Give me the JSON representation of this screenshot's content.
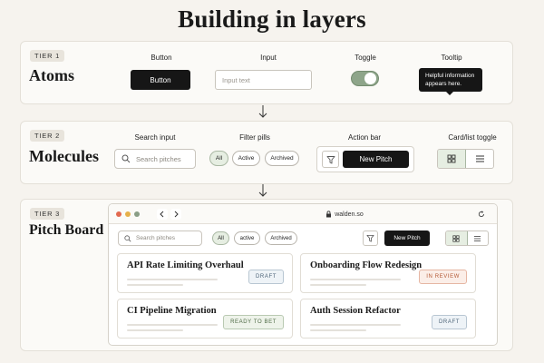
{
  "title": "Building in layers",
  "tiers": [
    {
      "badge": "TIER 1",
      "name": "Atoms",
      "columns": {
        "button": "Button",
        "input": "Input",
        "toggle": "Toggle",
        "tooltip": "Tooltip"
      },
      "button_label": "Button",
      "input_placeholder": "Input text",
      "toggle_on": true,
      "tooltip_text": "Helpful information appears here."
    },
    {
      "badge": "TIER 2",
      "name": "Molecules",
      "columns": {
        "search": "Search input",
        "filter": "Filter pills",
        "action": "Action bar",
        "view": "Card/list toggle"
      },
      "search_placeholder": "Search pitches",
      "pills": [
        "All",
        "Active",
        "Archived"
      ],
      "active_pill": "All",
      "new_pitch_label": "New Pitch"
    },
    {
      "badge": "TIER 3",
      "name": "Pitch Board"
    }
  ],
  "board": {
    "url": "walden.so",
    "search_placeholder": "Search pitches",
    "pills": [
      "All",
      "active",
      "Archived"
    ],
    "new_pitch_label": "New Pitch",
    "cards": [
      {
        "title": "API Rate Limiting Overhaul",
        "status": "DRAFT"
      },
      {
        "title": "Onboarding Flow Redesign",
        "status": "IN REVIEW"
      },
      {
        "title": "CI Pipeline Migration",
        "status": "READY TO BET"
      },
      {
        "title": "Auth Session Refactor",
        "status": "DRAFT"
      }
    ]
  },
  "colors": {
    "background": "#f6f3ee",
    "dark": "#161616",
    "sage": "#8ea58a",
    "draft": "#4d6478",
    "review": "#b45a36",
    "ready": "#4e6a45"
  },
  "icons": [
    "arrow-down-icon",
    "search-icon",
    "filter-icon",
    "grid-icon",
    "list-icon",
    "lock-icon",
    "refresh-icon",
    "chevron-left-icon",
    "chevron-right-icon"
  ]
}
